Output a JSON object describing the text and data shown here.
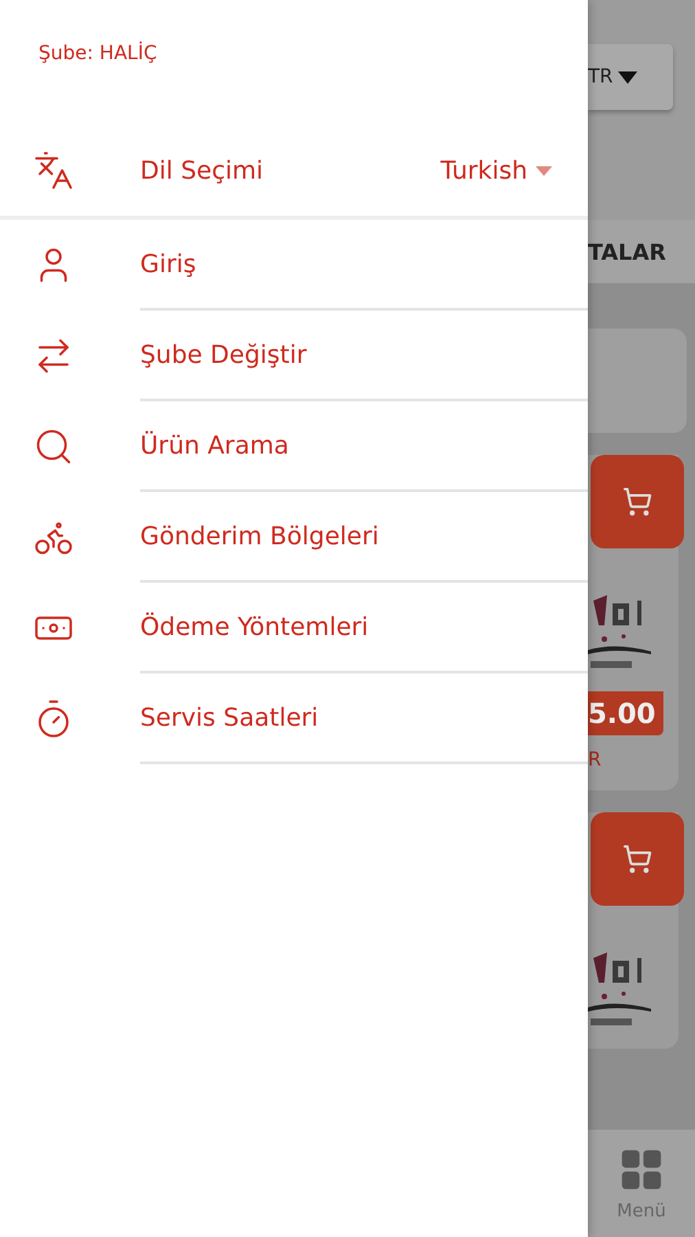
{
  "branch_label": "Şube: HALİÇ",
  "language": {
    "label": "Dil Seçimi",
    "value": "Turkish"
  },
  "menu_items": [
    {
      "label": "Giriş"
    },
    {
      "label": "Şube Değiştir"
    },
    {
      "label": "Ürün Arama"
    },
    {
      "label": "Gönderim Bölgeleri"
    },
    {
      "label": "Ödeme Yöntemleri"
    },
    {
      "label": "Servis Saatleri"
    }
  ],
  "background": {
    "language_button": "TR",
    "tab_label": "TALAR",
    "product_cards": [
      {
        "kind": "priced",
        "price": "5.00",
        "price_note": "R"
      },
      {
        "kind": "plain"
      }
    ],
    "nav_label": "Menü"
  }
}
